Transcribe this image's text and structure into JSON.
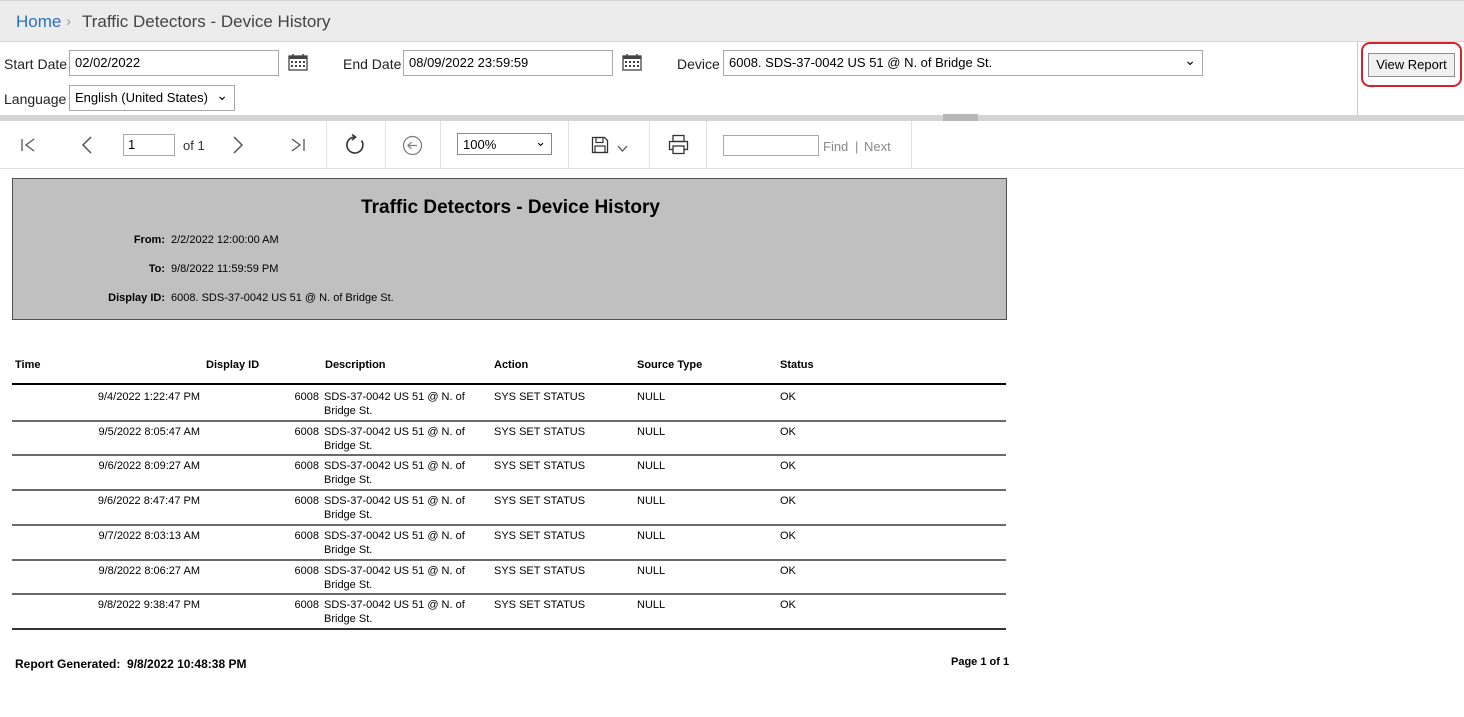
{
  "breadcrumb": {
    "home": "Home",
    "separator": "›",
    "current": "Traffic Detectors - Device History"
  },
  "params": {
    "start_date_label": "Start Date",
    "start_date_value": "02/02/2022",
    "end_date_label": "End Date",
    "end_date_value": "08/09/2022 23:59:59",
    "device_label": "Device",
    "device_value": "6008. SDS-37-0042 US 51 @ N. of Bridge St.",
    "language_label": "Language",
    "language_value": "English (United States)",
    "view_report": "View Report"
  },
  "toolbar": {
    "page_value": "1",
    "of_pages": "of 1",
    "zoom_value": "100%",
    "find_placeholder": "",
    "find_label": "Find",
    "separator": "|",
    "next_label": "Next"
  },
  "report": {
    "title": "Traffic Detectors - Device History",
    "from_label": "From:",
    "from_value": "2/2/2022 12:00:00 AM",
    "to_label": "To:",
    "to_value": "9/8/2022 11:59:59 PM",
    "display_id_label": "Display ID:",
    "display_id_value": "6008. SDS-37-0042 US 51 @ N. of Bridge St.",
    "columns": {
      "time": "Time",
      "display_id": "Display ID",
      "description": "Description",
      "action": "Action",
      "source_type": "Source Type",
      "status": "Status"
    },
    "rows": [
      {
        "time": "9/4/2022 1:22:47 PM",
        "display_id": "6008",
        "description": "SDS-37-0042 US 51 @ N. of Bridge St.",
        "action": "SYS SET STATUS",
        "source_type": "NULL",
        "status": "OK"
      },
      {
        "time": "9/5/2022 8:05:47 AM",
        "display_id": "6008",
        "description": "SDS-37-0042 US 51 @ N. of Bridge St.",
        "action": "SYS SET STATUS",
        "source_type": "NULL",
        "status": "OK"
      },
      {
        "time": "9/6/2022 8:09:27 AM",
        "display_id": "6008",
        "description": "SDS-37-0042 US 51 @ N. of Bridge St.",
        "action": "SYS SET STATUS",
        "source_type": "NULL",
        "status": "OK"
      },
      {
        "time": "9/6/2022 8:47:47 PM",
        "display_id": "6008",
        "description": "SDS-37-0042 US 51 @ N. of Bridge St.",
        "action": "SYS SET STATUS",
        "source_type": "NULL",
        "status": "OK"
      },
      {
        "time": "9/7/2022 8:03:13 AM",
        "display_id": "6008",
        "description": "SDS-37-0042 US 51 @ N. of Bridge St.",
        "action": "SYS SET STATUS",
        "source_type": "NULL",
        "status": "OK"
      },
      {
        "time": "9/8/2022 8:06:27 AM",
        "display_id": "6008",
        "description": "SDS-37-0042 US 51 @ N. of Bridge St.",
        "action": "SYS SET STATUS",
        "source_type": "NULL",
        "status": "OK"
      },
      {
        "time": "9/8/2022 9:38:47 PM",
        "display_id": "6008",
        "description": "SDS-37-0042 US 51 @ N. of Bridge St.",
        "action": "SYS SET STATUS",
        "source_type": "NULL",
        "status": "OK"
      }
    ],
    "generated_label": "Report Generated:",
    "generated_value": "9/8/2022 10:48:38 PM",
    "page_footer": "Page 1 of 1"
  },
  "colors": {
    "link": "#2a6fc7",
    "header_bg": "#c0c0c0",
    "highlight_ring": "#d2232a"
  }
}
